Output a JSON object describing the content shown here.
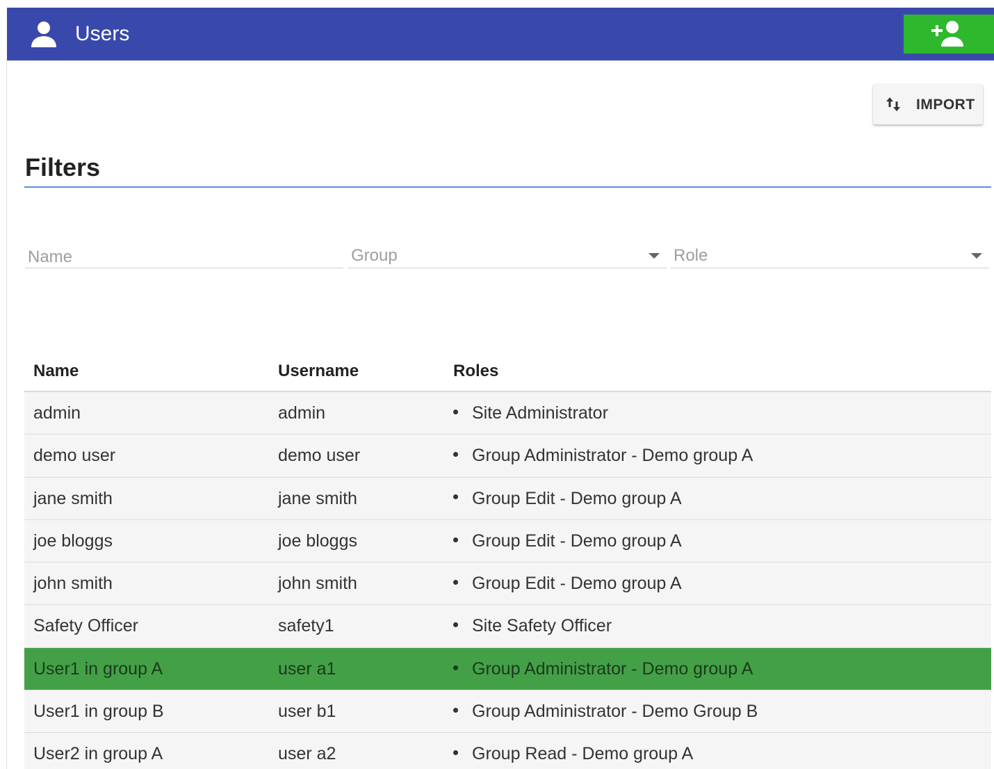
{
  "header": {
    "title": "Users",
    "icon": "person-icon",
    "add_button_icon": "add-person-icon",
    "bar_color": "#3949ab",
    "add_button_color": "#2eb82e"
  },
  "import_button": {
    "label": "IMPORT",
    "icon": "swap-vertical-icon"
  },
  "filters": {
    "title": "Filters",
    "name_placeholder": "Name",
    "group_placeholder": "Group",
    "role_placeholder": "Role"
  },
  "table": {
    "columns": [
      "Name",
      "Username",
      "Roles"
    ],
    "selected_color": "#43a047",
    "rows": [
      {
        "name": "admin",
        "username": "admin",
        "role": "Site Administrator"
      },
      {
        "name": "demo user",
        "username": "demo user",
        "role": "Group Administrator - Demo group A"
      },
      {
        "name": "jane smith",
        "username": "jane smith",
        "role": "Group Edit - Demo group A"
      },
      {
        "name": "joe bloggs",
        "username": "joe bloggs",
        "role": "Group Edit - Demo group A"
      },
      {
        "name": "john smith",
        "username": "john smith",
        "role": "Group Edit - Demo group A"
      },
      {
        "name": "Safety Officer",
        "username": "safety1",
        "role": "Site Safety Officer"
      },
      {
        "name": "User1 in group A",
        "username": "user a1",
        "role": "Group Administrator - Demo group A",
        "selected": true
      },
      {
        "name": "User1 in group B",
        "username": "user b1",
        "role": "Group Administrator - Demo Group B"
      },
      {
        "name": "User2 in group A",
        "username": "user a2",
        "role": "Group Read - Demo group A"
      }
    ]
  }
}
